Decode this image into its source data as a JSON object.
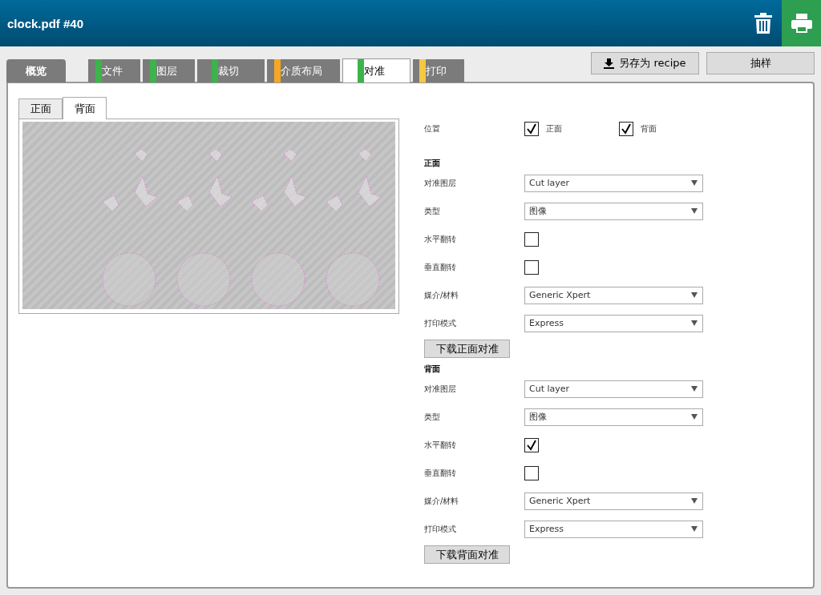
{
  "header": {
    "title": "clock.pdf #40"
  },
  "tabs": [
    {
      "label": "概览",
      "kind": "overview",
      "selected": false
    },
    {
      "label": "文件",
      "kind": "step",
      "color": "#3cb44b",
      "selected": false
    },
    {
      "label": "图层",
      "kind": "step",
      "color": "#3cb44b",
      "selected": false
    },
    {
      "label": "裁切",
      "kind": "step",
      "color": "#3cb44b",
      "selected": false
    },
    {
      "label": "介质布局",
      "kind": "step",
      "color": "#f5a623",
      "selected": false
    },
    {
      "label": "对准",
      "kind": "step",
      "color": "#3cb44b",
      "selected": true
    },
    {
      "label": "打印",
      "kind": "step",
      "color": "#f5c842",
      "selected": false
    }
  ],
  "actions": [
    {
      "label": "另存为 recipe",
      "kind": "download"
    },
    {
      "label": "抽样",
      "kind": "plain"
    }
  ],
  "preview_tabs": [
    {
      "label": "正面",
      "selected": false
    },
    {
      "label": "背面",
      "selected": true
    }
  ],
  "position": {
    "label": "位置",
    "options": [
      {
        "label": "正面",
        "checked": true
      },
      {
        "label": "背面",
        "checked": true
      }
    ]
  },
  "sections": [
    {
      "title": "正面",
      "fields": [
        {
          "kind": "select",
          "label": "对准图层",
          "value": "Cut layer"
        },
        {
          "kind": "select",
          "label": "类型",
          "value": "图像"
        },
        {
          "kind": "checkbox",
          "label": "水平翻转",
          "checked": false
        },
        {
          "kind": "checkbox",
          "label": "垂直翻转",
          "checked": false
        },
        {
          "kind": "select",
          "label": "媒介/材料",
          "value": "Generic Xpert"
        },
        {
          "kind": "select",
          "label": "打印模式",
          "value": "Express"
        }
      ],
      "button": "下载正面对准"
    },
    {
      "title": "背面",
      "fields": [
        {
          "kind": "select",
          "label": "对准图层",
          "value": "Cut layer"
        },
        {
          "kind": "select",
          "label": "类型",
          "value": "图像"
        },
        {
          "kind": "checkbox",
          "label": "水平翻转",
          "checked": true
        },
        {
          "kind": "checkbox",
          "label": "垂直翻转",
          "checked": false
        },
        {
          "kind": "select",
          "label": "媒介/材料",
          "value": "Generic Xpert"
        },
        {
          "kind": "select",
          "label": "打印模式",
          "value": "Express"
        }
      ],
      "button": "下载背面对准"
    }
  ]
}
